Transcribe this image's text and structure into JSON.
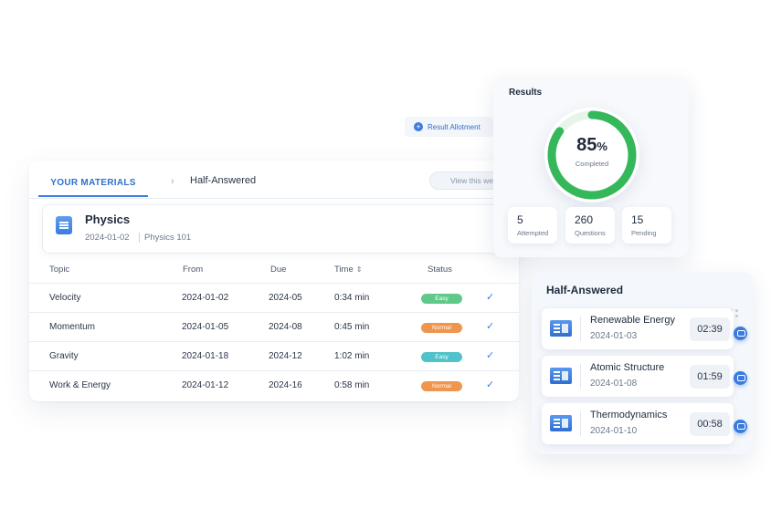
{
  "colors": {
    "accent": "#3b7be0",
    "easy": "#5fc98a",
    "easy_alt": "#4fc3c9",
    "normal": "#f0954d",
    "gauge": "#34b85a"
  },
  "allotment": {
    "label": "Result Allotment",
    "icon": "plus-circle-icon"
  },
  "materials": {
    "tab_active": "YOUR MATERIALS",
    "separator": "›",
    "tab_current": "Half-Answered",
    "view_filter": "View this week",
    "course": {
      "title": "Physics",
      "date": "2024-01-02",
      "code": "Physics 101",
      "icon": "document-icon"
    },
    "columns": [
      "Topic",
      "From",
      "Due",
      "Time",
      "Status"
    ],
    "sort_icon": "⇕",
    "rows": [
      {
        "topic": "Velocity",
        "from": "2024-01-02",
        "due": "2024-05",
        "time": "0:34 min",
        "status": "Easy",
        "check": "✓"
      },
      {
        "topic": "Momentum",
        "from": "2024-01-05",
        "due": "2024-08",
        "time": "0:45 min",
        "status": "Normal",
        "check": "✓"
      },
      {
        "topic": "Gravity",
        "from": "2024-01-18",
        "due": "2024-12",
        "time": "1:02 min",
        "status": "Easy",
        "check": "✓"
      },
      {
        "topic": "Work & Energy",
        "from": "2024-01-12",
        "due": "2024-16",
        "time": "0:58 min",
        "status": "Normal",
        "check": "✓"
      }
    ]
  },
  "results": {
    "title": "Results",
    "percent": 85,
    "percent_value": "85",
    "percent_sign": "%",
    "completed_label": "Completed",
    "stats": [
      {
        "value": "5",
        "label": "Attempted"
      },
      {
        "value": "260",
        "label": "Questions"
      },
      {
        "value": "15",
        "label": "Pending"
      }
    ]
  },
  "half_answered": {
    "title": "Half-Answered",
    "items": [
      {
        "name": "Renewable Energy",
        "date": "2024-01-03",
        "time": "02:39"
      },
      {
        "name": "Atomic Structure",
        "date": "2024-01-08",
        "time": "01:59"
      },
      {
        "name": "Thermodynamics",
        "date": "2024-01-10",
        "time": "00:58"
      }
    ]
  }
}
